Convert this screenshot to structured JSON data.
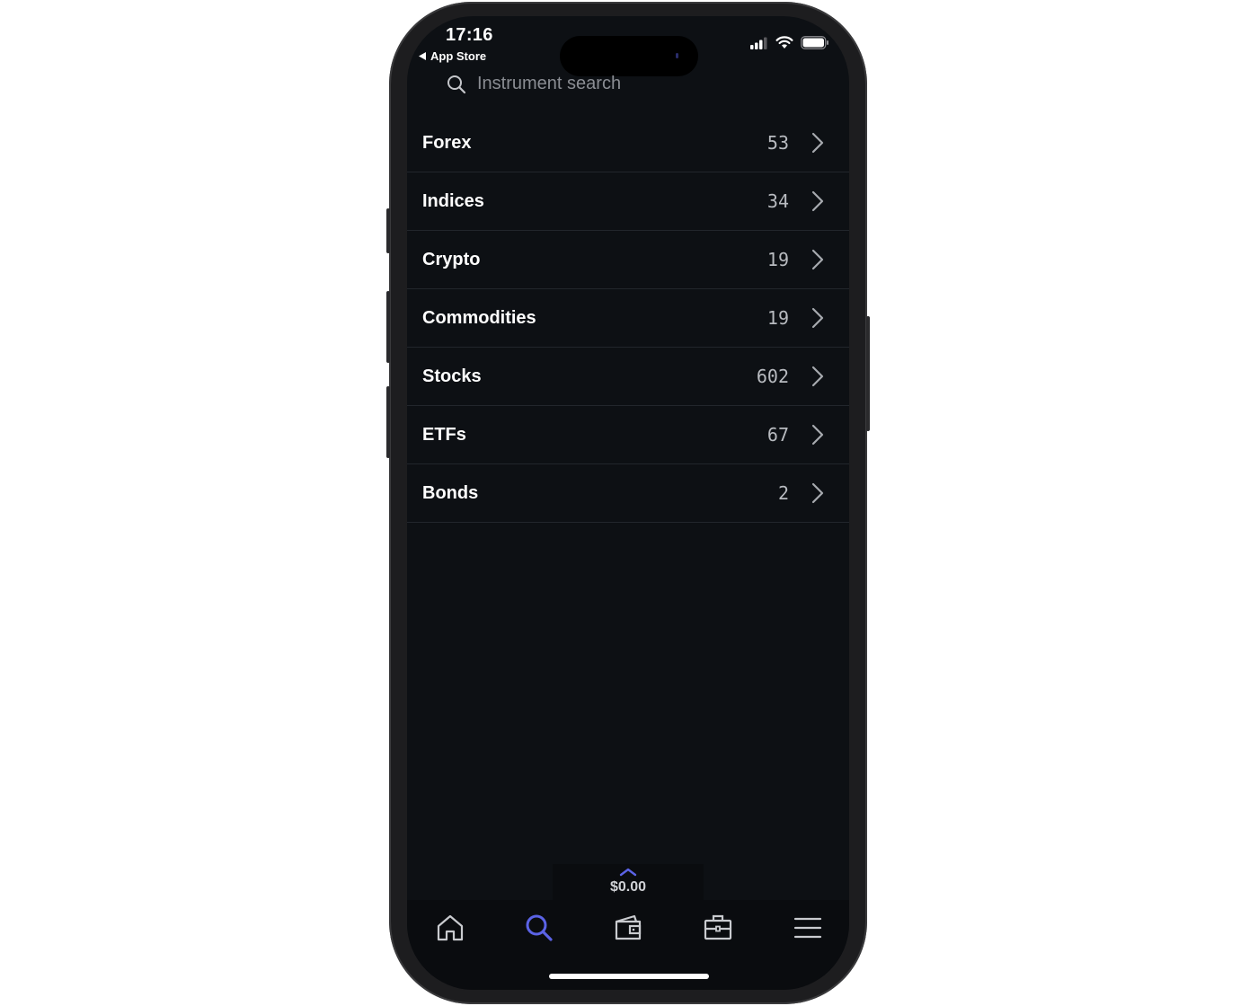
{
  "status_bar": {
    "time": "17:16",
    "back_label": "App Store"
  },
  "search": {
    "placeholder": "Instrument search"
  },
  "categories": [
    {
      "label": "Forex",
      "count": "53"
    },
    {
      "label": "Indices",
      "count": "34"
    },
    {
      "label": "Crypto",
      "count": "19"
    },
    {
      "label": "Commodities",
      "count": "19"
    },
    {
      "label": "Stocks",
      "count": "602"
    },
    {
      "label": "ETFs",
      "count": "67"
    },
    {
      "label": "Bonds",
      "count": "2"
    }
  ],
  "balance": {
    "value": "$0.00"
  },
  "tabbar": {
    "items": [
      {
        "icon": "home-icon",
        "active": false
      },
      {
        "icon": "search-icon",
        "active": true
      },
      {
        "icon": "wallet-icon",
        "active": false
      },
      {
        "icon": "briefcase-icon",
        "active": false
      },
      {
        "icon": "menu-icon",
        "active": false
      }
    ]
  },
  "colors": {
    "background": "#0d1014",
    "accent": "#5b63e6",
    "text": "#ffffff",
    "muted": "#8a8d93"
  }
}
